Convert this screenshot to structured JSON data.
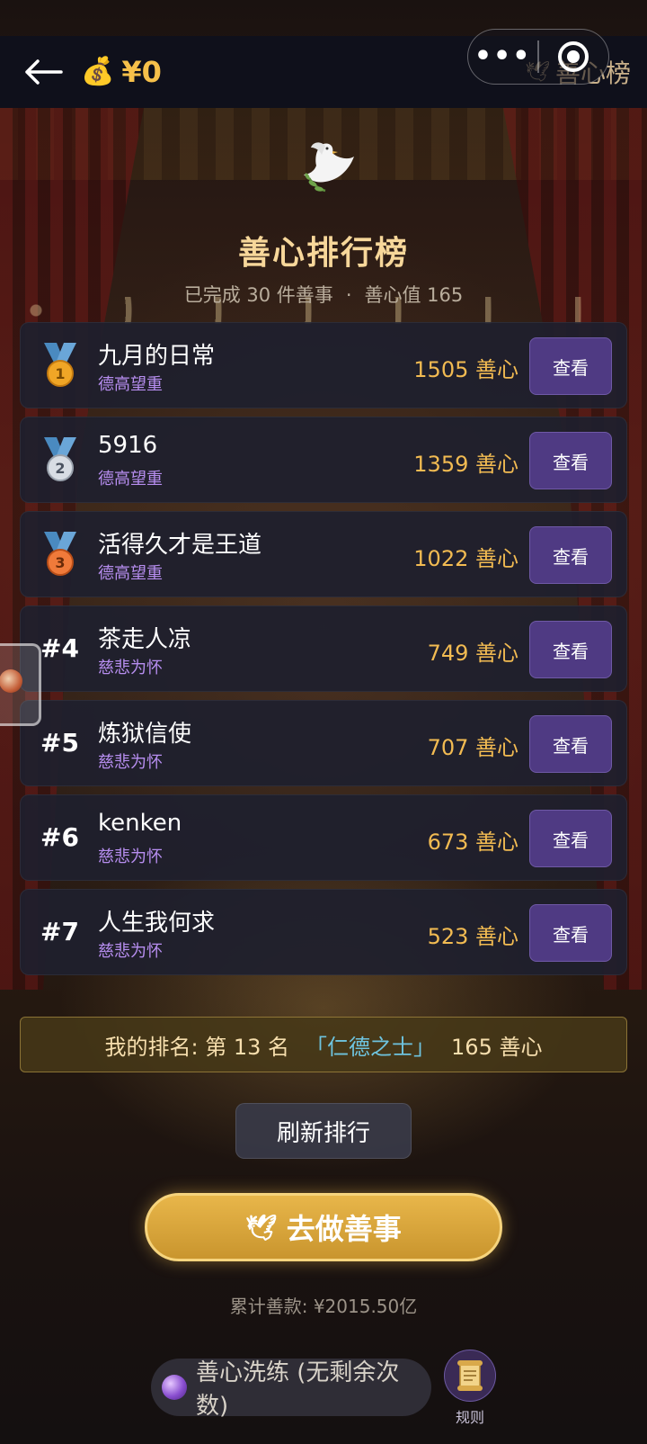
{
  "header": {
    "balance": "¥0",
    "nav_title": "善心榜",
    "more_glyph": "•••",
    "icons": {
      "back": "back-arrow-icon",
      "money": "money-bag-icon",
      "dove": "dove-icon"
    }
  },
  "page": {
    "title": "善心排行榜",
    "completed": "已完成 30 件善事",
    "separator": "·",
    "kindness_value": "善心值 165"
  },
  "leaderboard": [
    {
      "rank": "1",
      "name": "九月的日常",
      "title": "德高望重",
      "score": "1505 善心",
      "button": "查看",
      "medal": "gold"
    },
    {
      "rank": "2",
      "name": "5916",
      "title": "德高望重",
      "score": "1359 善心",
      "button": "查看",
      "medal": "silver"
    },
    {
      "rank": "3",
      "name": "活得久才是王道",
      "title": "德高望重",
      "score": "1022 善心",
      "button": "查看",
      "medal": "bronze"
    },
    {
      "rank": "#4",
      "name": "茶走人凉",
      "title": "慈悲为怀",
      "score": "749 善心",
      "button": "查看"
    },
    {
      "rank": "#5",
      "name": "炼狱信使",
      "title": "慈悲为怀",
      "score": "707 善心",
      "button": "查看"
    },
    {
      "rank": "#6",
      "name": "kenken",
      "title": "慈悲为怀",
      "score": "673 善心",
      "button": "查看"
    },
    {
      "rank": "#7",
      "name": "人生我何求",
      "title": "慈悲为怀",
      "score": "523 善心",
      "button": "查看"
    }
  ],
  "my_rank": {
    "prefix": "我的排名: 第 13 名",
    "title": "「仁德之士」",
    "score": "165 善心"
  },
  "actions": {
    "refresh": "刷新排行",
    "do_good": "去做善事",
    "total": "累计善款: ¥2015.50亿",
    "refine": "善心洗练 (无剩余次数)",
    "rules": "规则"
  },
  "colors": {
    "gold_text": "#f2bb52",
    "title_purple": "#b78ef0",
    "button_purple": "#4f3a83",
    "cta_gold": "#e8b64a"
  }
}
